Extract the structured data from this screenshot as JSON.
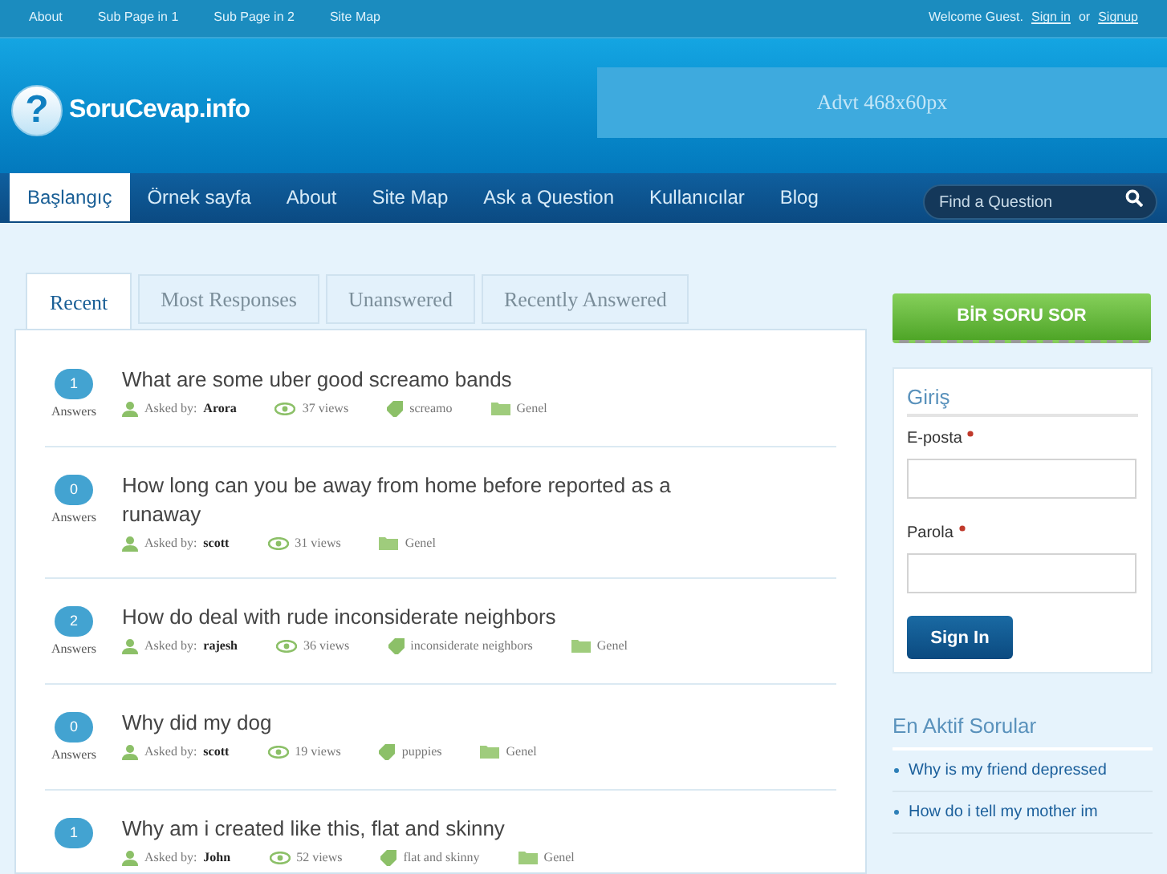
{
  "top_bar": {
    "links": [
      "About",
      "Sub Page in 1",
      "Sub Page in 2",
      "Site Map"
    ],
    "welcome": "Welcome Guest.",
    "sign_in": "Sign in",
    "or": "or",
    "signup": "Signup"
  },
  "header": {
    "logo_mark": "?",
    "logo_text": "SoruCevap.info",
    "ad": "Advt 468x60px"
  },
  "nav": {
    "items": [
      {
        "label": "Başlangıç",
        "selected": true
      },
      {
        "label": "Örnek sayfa",
        "selected": false
      },
      {
        "label": "About",
        "selected": false
      },
      {
        "label": "Site Map",
        "selected": false
      },
      {
        "label": "Ask a Question",
        "selected": false
      },
      {
        "label": "Kullanıcılar",
        "selected": false
      },
      {
        "label": "Blog",
        "selected": false
      }
    ],
    "search_placeholder": "Find a Question"
  },
  "tabs": [
    {
      "label": "Recent",
      "selected": true
    },
    {
      "label": "Most Responses",
      "selected": false
    },
    {
      "label": "Unanswered",
      "selected": false
    },
    {
      "label": "Recently Answered",
      "selected": false
    }
  ],
  "questions": [
    {
      "answers": "1",
      "answers_label": "Answers",
      "title": "What are some uber good screamo bands",
      "asked_by_label": "Asked by:",
      "author": "Arora",
      "views": "37 views",
      "tag": "screamo",
      "category": "Genel"
    },
    {
      "answers": "0",
      "answers_label": "Answers",
      "title": "How long can you be away from home before reported as a runaway",
      "asked_by_label": "Asked by:",
      "author": "scott",
      "views": "31 views",
      "category": "Genel"
    },
    {
      "answers": "2",
      "answers_label": "Answers",
      "title": "How do deal with rude inconsiderate neighbors",
      "asked_by_label": "Asked by:",
      "author": "rajesh",
      "views": "36 views",
      "tag": "inconsiderate neighbors",
      "category": "Genel"
    },
    {
      "answers": "0",
      "answers_label": "Answers",
      "title": "Why did my dog",
      "asked_by_label": "Asked by:",
      "author": "scott",
      "views": "19 views",
      "tag": "puppies",
      "category": "Genel"
    },
    {
      "answers": "1",
      "title": "Why am i created like this, flat and skinny",
      "asked_by_label": "Asked by:",
      "author": "John",
      "views": "52 views",
      "tag": "flat and skinny",
      "category": "Genel"
    }
  ],
  "sidebar": {
    "ask_button": "BİR SORU SOR",
    "login": {
      "title": "Giriş",
      "fields": [
        {
          "label": "E-posta",
          "required": true
        },
        {
          "label": "Parola",
          "required": true
        }
      ],
      "button": "Sign In"
    },
    "active": {
      "title": "En Aktif Sorular",
      "items": [
        "Why is my friend depressed",
        "How do i tell my mother im"
      ]
    }
  }
}
